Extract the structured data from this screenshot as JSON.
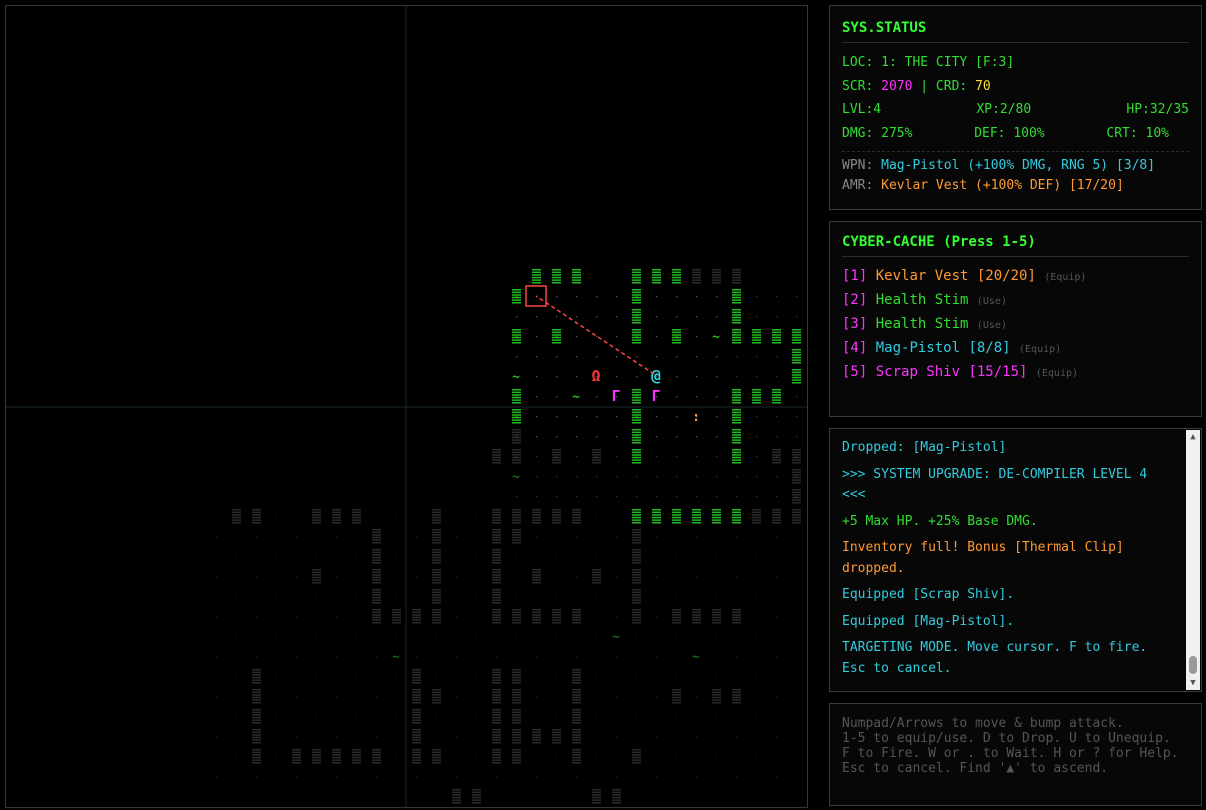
{
  "status": {
    "title": "SYS.STATUS",
    "loc_label": "LOC:",
    "loc_value": "1: THE CITY [F:3]",
    "scr_label": "SCR:",
    "scr_value": "2070",
    "crd_sep": "| CRD:",
    "crd_value": "70",
    "lvl": "LVL:4",
    "xp": "XP:2/80",
    "hp": "HP:32/35",
    "dmg": "DMG: 275%",
    "def": "DEF: 100%",
    "crt": "CRT: 10%",
    "wpn_label": "WPN:",
    "wpn_value": "Mag-Pistol (+100% DMG, RNG 5) [3/8]",
    "amr_label": "AMR:",
    "amr_value": "Kevlar Vest (+100% DEF) [17/20]"
  },
  "cache": {
    "title": "CYBER-CACHE (Press 1-5)",
    "items": [
      {
        "key": "[1]",
        "name": "Kevlar Vest [20/20]",
        "action": "(Equip)",
        "color": "#ff9933"
      },
      {
        "key": "[2]",
        "name": "Health Stim",
        "action": "(Use)",
        "color": "#33dd33"
      },
      {
        "key": "[3]",
        "name": "Health Stim",
        "action": "(Use)",
        "color": "#33dd33"
      },
      {
        "key": "[4]",
        "name": "Mag-Pistol [8/8]",
        "action": "(Equip)",
        "color": "#33ccdd"
      },
      {
        "key": "[5]",
        "name": "Scrap Shiv [15/15]",
        "action": "(Equip)",
        "color": "#ff33ff"
      }
    ]
  },
  "log": [
    {
      "text": "Dropped: [Mag-Pistol]",
      "color": "#33ccdd"
    },
    {
      "text": ">>> SYSTEM UPGRADE: DE-COMPILER LEVEL 4 <<<",
      "color": "#33ccdd"
    },
    {
      "text": "+5 Max HP. +25% Base DMG.",
      "color": "#33dd33"
    },
    {
      "text": "Inventory full! Bonus [Thermal Clip] dropped.",
      "color": "#ff9933"
    },
    {
      "text": "Equipped [Scrap Shiv].",
      "color": "#33ccdd"
    },
    {
      "text": "Equipped [Mag-Pistol].",
      "color": "#33ccdd"
    },
    {
      "text": "TARGETING MODE. Move cursor. F to fire. Esc to cancel.",
      "color": "#33ccdd"
    }
  ],
  "help": [
    "Numpad/Arrows to move & bump attack.",
    "1-5 to equip/use. D to Drop. U to Unequip.",
    "F to Fire. W or . to Wait. H or ? for Help.",
    "Esc to cancel. Find '▲' to ascend."
  ],
  "map": {
    "player": "@",
    "enemy_red": "Ω",
    "enemy_mag": "Γ",
    "vine": "~",
    "item": ":",
    "target_glyph": "·"
  },
  "colors": {
    "wall_visible": "#22bb22",
    "wall_remembered": "#2a2a2a",
    "floor": "#3a3a3a",
    "player": "#33dddd",
    "enemy_red": "#ff3333",
    "enemy_mag": "#ff33ff",
    "target_box": "#ff4444",
    "accent": "#33ff33"
  }
}
